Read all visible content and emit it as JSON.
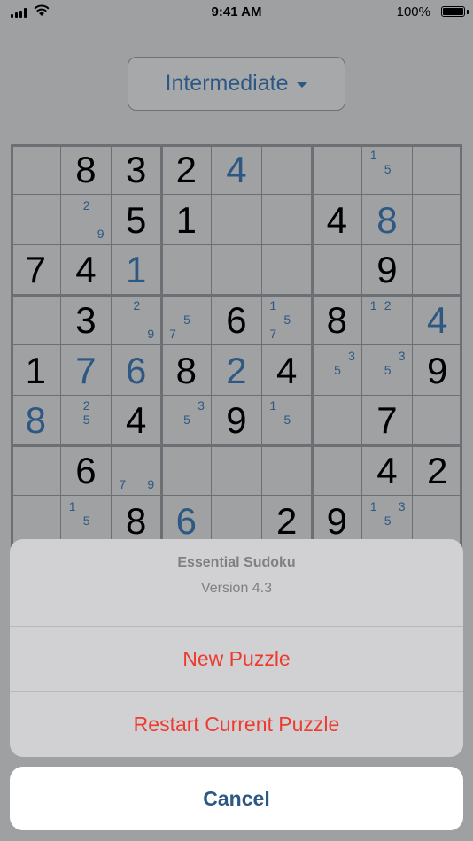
{
  "status_bar": {
    "time": "9:41 AM",
    "battery_text": "100%"
  },
  "difficulty": {
    "label": "Intermediate"
  },
  "board": {
    "cells": [
      [
        {
          "v": ""
        },
        {
          "v": "8"
        },
        {
          "v": "3"
        },
        {
          "v": "2"
        },
        {
          "v": "4",
          "user": true
        },
        {
          "v": ""
        },
        {
          "v": ""
        },
        {
          "v": "",
          "n": [
            "1",
            "5"
          ]
        },
        {
          "v": ""
        }
      ],
      [
        {
          "v": ""
        },
        {
          "v": "",
          "n": [
            "2",
            "9"
          ]
        },
        {
          "v": "5"
        },
        {
          "v": "1"
        },
        {
          "v": ""
        },
        {
          "v": ""
        },
        {
          "v": "4"
        },
        {
          "v": "8",
          "user": true
        },
        {
          "v": ""
        }
      ],
      [
        {
          "v": "7"
        },
        {
          "v": "4"
        },
        {
          "v": "1",
          "user": true
        },
        {
          "v": ""
        },
        {
          "v": ""
        },
        {
          "v": ""
        },
        {
          "v": ""
        },
        {
          "v": "9"
        },
        {
          "v": ""
        }
      ],
      [
        {
          "v": ""
        },
        {
          "v": "3"
        },
        {
          "v": "",
          "n": [
            "2",
            "9"
          ]
        },
        {
          "v": "",
          "n": [
            "5",
            "7"
          ]
        },
        {
          "v": "6"
        },
        {
          "v": "",
          "n": [
            "1",
            "5",
            "7"
          ]
        },
        {
          "v": "8"
        },
        {
          "v": "",
          "n": [
            "1",
            "2"
          ]
        },
        {
          "v": "4",
          "user": true
        }
      ],
      [
        {
          "v": "1"
        },
        {
          "v": "7",
          "user": true
        },
        {
          "v": "6",
          "user": true
        },
        {
          "v": "8"
        },
        {
          "v": "2",
          "user": true
        },
        {
          "v": "4"
        },
        {
          "v": "",
          "n": [
            "3",
            "5"
          ]
        },
        {
          "v": "",
          "n": [
            "3",
            "5"
          ]
        },
        {
          "v": "9"
        }
      ],
      [
        {
          "v": "8",
          "user": true
        },
        {
          "v": "",
          "n": [
            "2",
            "5"
          ]
        },
        {
          "v": "4"
        },
        {
          "v": "",
          "n": [
            "3",
            "5"
          ]
        },
        {
          "v": "9"
        },
        {
          "v": "",
          "n": [
            "1",
            "5"
          ]
        },
        {
          "v": ""
        },
        {
          "v": "7"
        },
        {
          "v": ""
        }
      ],
      [
        {
          "v": ""
        },
        {
          "v": "6"
        },
        {
          "v": "",
          "n": [
            "7",
            "9"
          ]
        },
        {
          "v": ""
        },
        {
          "v": ""
        },
        {
          "v": ""
        },
        {
          "v": ""
        },
        {
          "v": "4"
        },
        {
          "v": "2"
        }
      ],
      [
        {
          "v": ""
        },
        {
          "v": "",
          "n": [
            "1",
            "5"
          ]
        },
        {
          "v": "8"
        },
        {
          "v": "6",
          "user": true
        },
        {
          "v": ""
        },
        {
          "v": "2"
        },
        {
          "v": "9"
        },
        {
          "v": "",
          "n": [
            "1",
            "3",
            "5"
          ]
        },
        {
          "v": ""
        }
      ],
      [
        {
          "v": ""
        },
        {
          "v": ""
        },
        {
          "v": ""
        },
        {
          "v": ""
        },
        {
          "v": ""
        },
        {
          "v": ""
        },
        {
          "v": ""
        },
        {
          "v": ""
        },
        {
          "v": ""
        }
      ]
    ]
  },
  "action_sheet": {
    "title": "Essential Sudoku",
    "subtitle": "Version 4.3",
    "buttons": [
      "New Puzzle",
      "Restart Current Puzzle"
    ],
    "cancel": "Cancel",
    "destructive_color": "#ee3b2f",
    "cancel_color": "#2d5883"
  }
}
